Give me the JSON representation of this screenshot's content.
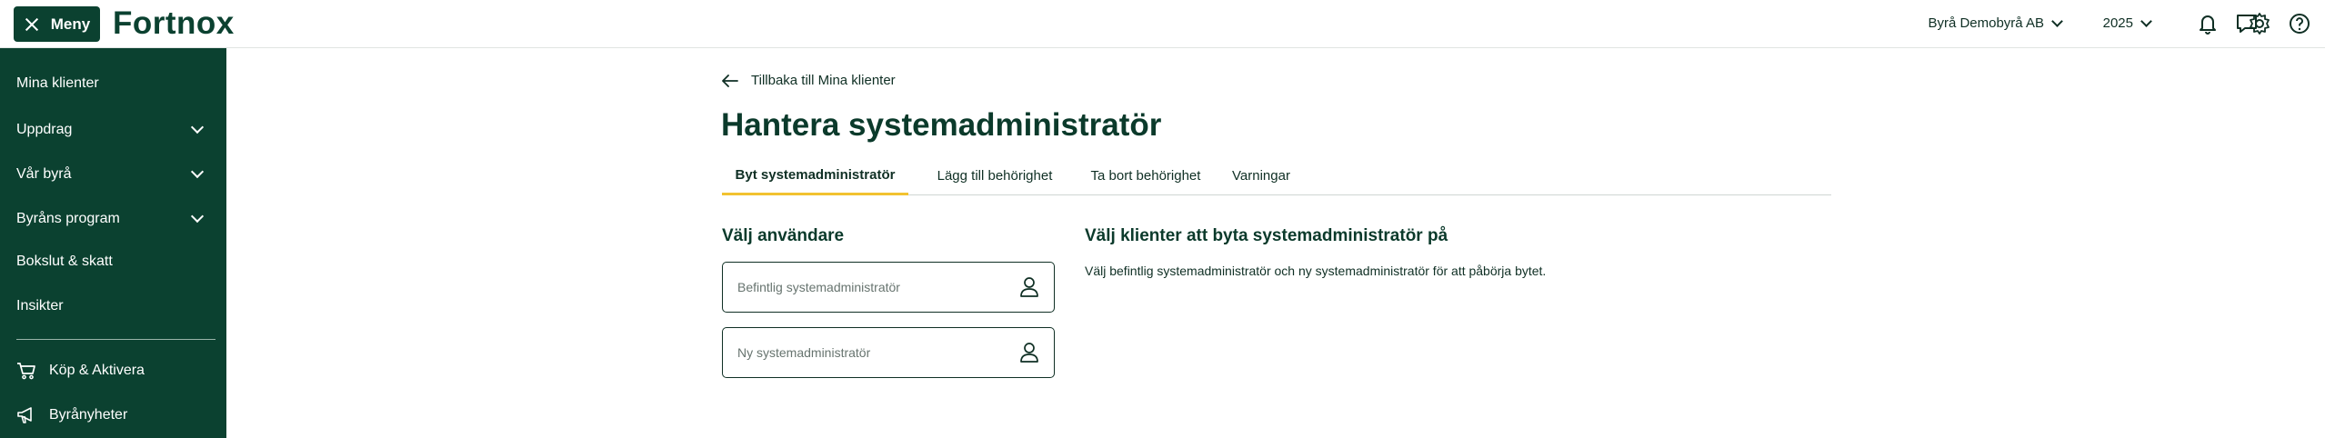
{
  "topbar": {
    "menu_label": "Meny",
    "logo": "Fortnox",
    "company": "Byrå Demobyrå AB",
    "year": "2025"
  },
  "sidebar": {
    "items": [
      {
        "label": "Mina klienter"
      },
      {
        "label": "Uppdrag"
      },
      {
        "label": "Vår byrå"
      },
      {
        "label": "Byråns program"
      },
      {
        "label": "Bokslut & skatt"
      },
      {
        "label": "Insikter"
      },
      {
        "label": "Köp & Aktivera"
      },
      {
        "label": "Byrånyheter"
      }
    ]
  },
  "main": {
    "back_label": "Tillbaka till Mina klienter",
    "title": "Hantera systemadministratör",
    "tabs": [
      {
        "label": "Byt systemadministratör"
      },
      {
        "label": "Lägg till behörighet"
      },
      {
        "label": "Ta bort behörighet"
      },
      {
        "label": "Varningar"
      }
    ],
    "select_user_heading": "Välj användare",
    "current_admin_placeholder": "Befintlig systemadministratör",
    "new_admin_placeholder": "Ny systemadministratör",
    "clients_heading": "Välj klienter att byta systemadministratör på",
    "clients_description": "Välj befintlig systemadministratör och ny systemadministratör för att påbörja bytet."
  },
  "colors": {
    "brand_green": "#0b4130",
    "active_tab_underline": "#f2c230"
  },
  "icons": [
    "close-icon",
    "chevron-down-icon",
    "chat-icon",
    "bell-icon",
    "gear-icon",
    "help-icon",
    "arrow-left-icon",
    "cart-icon",
    "megaphone-icon",
    "user-icon"
  ]
}
